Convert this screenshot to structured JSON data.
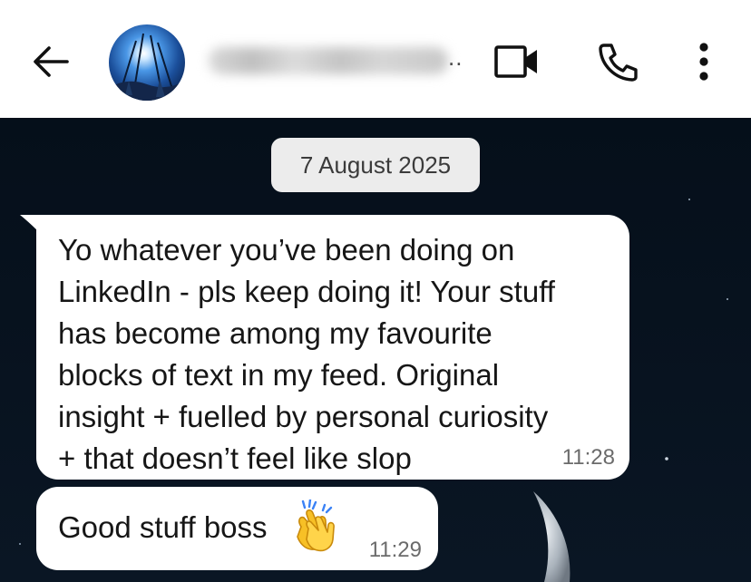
{
  "header": {
    "back_icon": "arrow-left-icon",
    "avatar_icon": "contact-avatar",
    "contact_name_ellipsis": "..",
    "video_icon": "video-camera-icon",
    "call_icon": "phone-icon",
    "menu_icon": "more-vertical-icon"
  },
  "chat": {
    "date_label": "7 August 2025",
    "messages": [
      {
        "text": "Yo whatever you’ve been doing on\nLinkedIn - pls keep doing it! Your stuff\nhas become among my favourite\nblocks of text in my feed. Original\ninsight + fuelled by personal curiosity\n+ that doesn’t feel like slop",
        "time": "11:28"
      },
      {
        "text": "Good stuff boss",
        "emoji_icon": "clapping-hands-icon",
        "time": "11:29"
      }
    ]
  },
  "colors": {
    "header_bg": "#ffffff",
    "chat_bg": "#06111c",
    "bubble_bg": "#ffffff",
    "date_chip_bg": "#ececec"
  }
}
